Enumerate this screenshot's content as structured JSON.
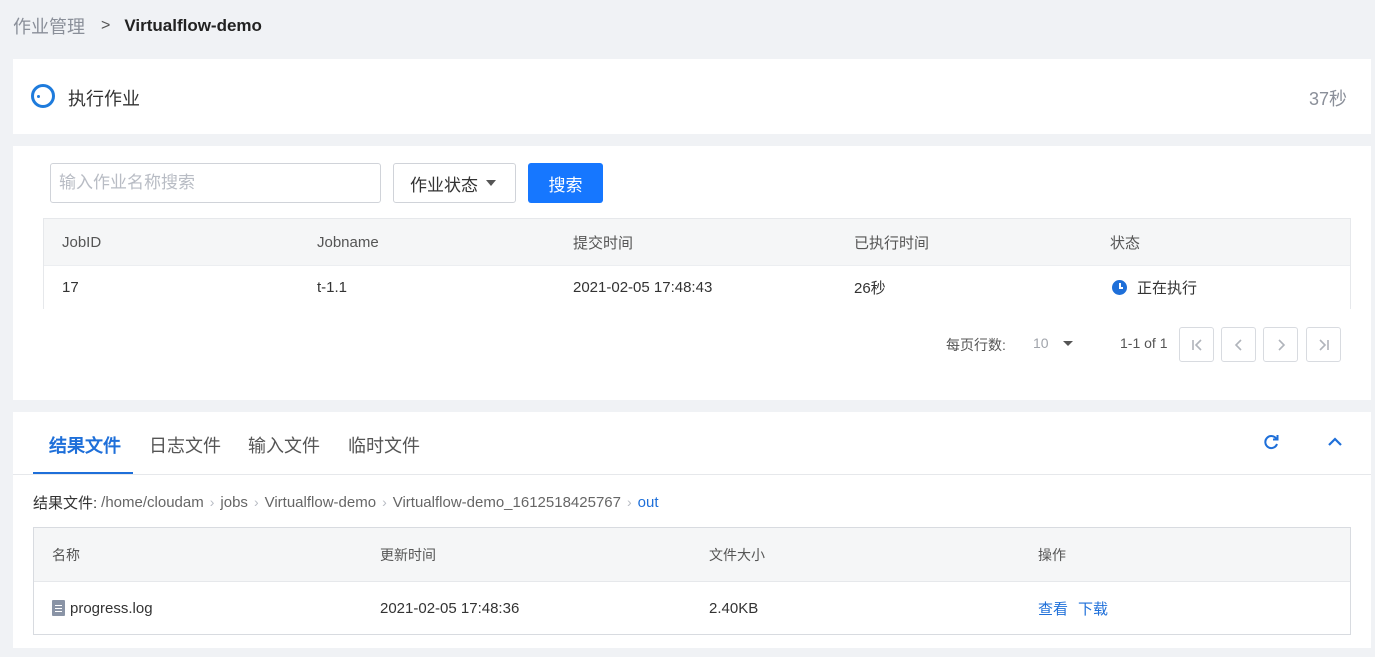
{
  "breadcrumb": {
    "parent": "作业管理",
    "separator": ">",
    "current": "Virtualflow-demo"
  },
  "status_card": {
    "title": "执行作业",
    "elapsed": "37秒"
  },
  "search": {
    "placeholder": "输入作业名称搜索",
    "status_filter_label": "作业状态",
    "button_label": "搜索"
  },
  "jobs_table": {
    "headers": [
      "JobID",
      "Jobname",
      "提交时间",
      "已执行时间",
      "状态"
    ],
    "rows": [
      {
        "job_id": "17",
        "job_name": "t-1.1",
        "submit_time": "2021-02-05 17:48:43",
        "elapsed": "26秒",
        "status": "正在执行"
      }
    ]
  },
  "pagination": {
    "rows_per_page_label": "每页行数:",
    "rows_per_page": "10",
    "range": "1-1 of 1"
  },
  "file_tabs": [
    {
      "label": "结果文件",
      "active": true
    },
    {
      "label": "日志文件",
      "active": false
    },
    {
      "label": "输入文件",
      "active": false
    },
    {
      "label": "临时文件",
      "active": false
    }
  ],
  "file_path": {
    "label": "结果文件:",
    "segments": [
      "/home/cloudam",
      "jobs",
      "Virtualflow-demo",
      "Virtualflow-demo_1612518425767",
      "out"
    ]
  },
  "files_table": {
    "headers": [
      "名称",
      "更新时间",
      "文件大小",
      "操作"
    ],
    "rows": [
      {
        "name": "progress.log",
        "updated": "2021-02-05 17:48:36",
        "size": "2.40KB",
        "action_view": "查看",
        "action_download": "下载"
      }
    ]
  },
  "icons": [
    "spinner-icon",
    "caret-down-icon",
    "clock-icon",
    "first-page-icon",
    "prev-page-icon",
    "next-page-icon",
    "last-page-icon",
    "refresh-icon",
    "collapse-icon",
    "file-icon"
  ],
  "colors": {
    "accent": "#1677ff",
    "link": "#1e6fd9",
    "background": "#f0f2f5"
  }
}
